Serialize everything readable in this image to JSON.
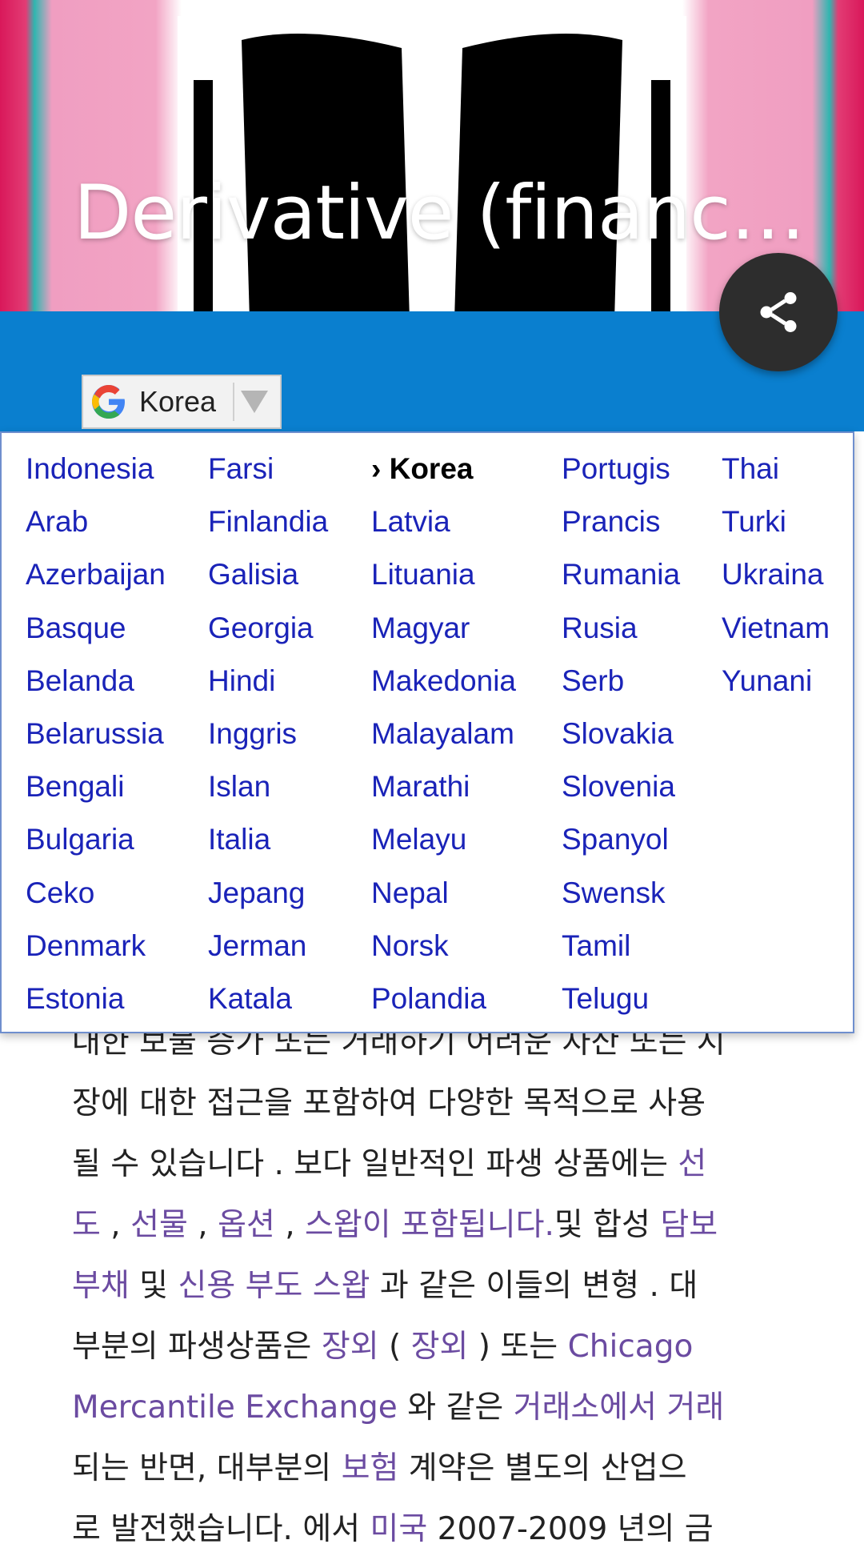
{
  "hero": {
    "title": "Derivative (finance)..."
  },
  "share": {
    "icon": "share-icon"
  },
  "language_select": {
    "current": "Korea",
    "icon": "google-g-icon",
    "arrow_icon": "dropdown-triangle-icon"
  },
  "language_menu": {
    "selected_marker": "›",
    "columns": [
      [
        "Indonesia",
        "Arab",
        "Azerbaijan",
        "Basque",
        "Belanda",
        "Belarussia",
        "Bengali",
        "Bulgaria",
        "Ceko",
        "Denmark",
        "Estonia"
      ],
      [
        "Farsi",
        "Finlandia",
        "Galisia",
        "Georgia",
        "Hindi",
        "Inggris",
        "Islan",
        "Italia",
        "Jepang",
        "Jerman",
        "Katala"
      ],
      [
        "Korea",
        "Latvia",
        "Lituania",
        "Magyar",
        "Makedonia",
        "Malayalam",
        "Marathi",
        "Melayu",
        "Nepal",
        "Norsk",
        "Polandia"
      ],
      [
        "Portugis",
        "Prancis",
        "Rumania",
        "Rusia",
        "Serb",
        "Slovakia",
        "Slovenia",
        "Spanyol",
        "Swensk",
        "Tamil",
        "Telugu"
      ],
      [
        "Thai",
        "Turki",
        "Ukraina",
        "Vietnam",
        "Yunani"
      ]
    ]
  },
  "article": {
    "l0": "대한 보물 증가 또는 거래하기 어려운 자산 또는 시",
    "l1": "장에 대한 접근을 포함하여 다양한 목적으로 사용",
    "l2_text": "될 수 있습니다 .  보다 일반적인 파생 상품에는  ",
    "l2_link": "선",
    "l3_link1": "도",
    "l3_sep1": " ,  ",
    "l3_link2": "선물",
    "l3_sep2": " ,  ",
    "l3_link3": "옵션",
    "l3_sep3": " ,  ",
    "l3_link4": "스왑이 포함됩니다.",
    "l3_text": "및 합성 ",
    "l3_link5": "담보",
    "l4_link1": "부채",
    "l4_text1": "  및 ",
    "l4_link2": "신용 부도 스왑",
    "l4_text2": " 과  같은 이들의 변형  . 대",
    "l5_text1": "부분의 파생상품은  ",
    "l5_link1": "장외",
    "l5_text2": "  ( ",
    "l5_link2": "장외",
    "l5_text3": " ) 또는 ",
    "l5_link3": "Chicago",
    "l6_link1": "Mercantile Exchange",
    "l6_text1": " 와 같은  ",
    "l6_link2": "거래소에서 거래",
    "l7_text1": "되는 반면, 대부분의  ",
    "l7_link1": "보험",
    "l7_text2": "  계약은 별도의 산업으",
    "l8_text1": "로 발전했습니다. 에서 ",
    "l8_link1": "미국",
    "l8_text2": " 2007-2009 년의 금"
  }
}
